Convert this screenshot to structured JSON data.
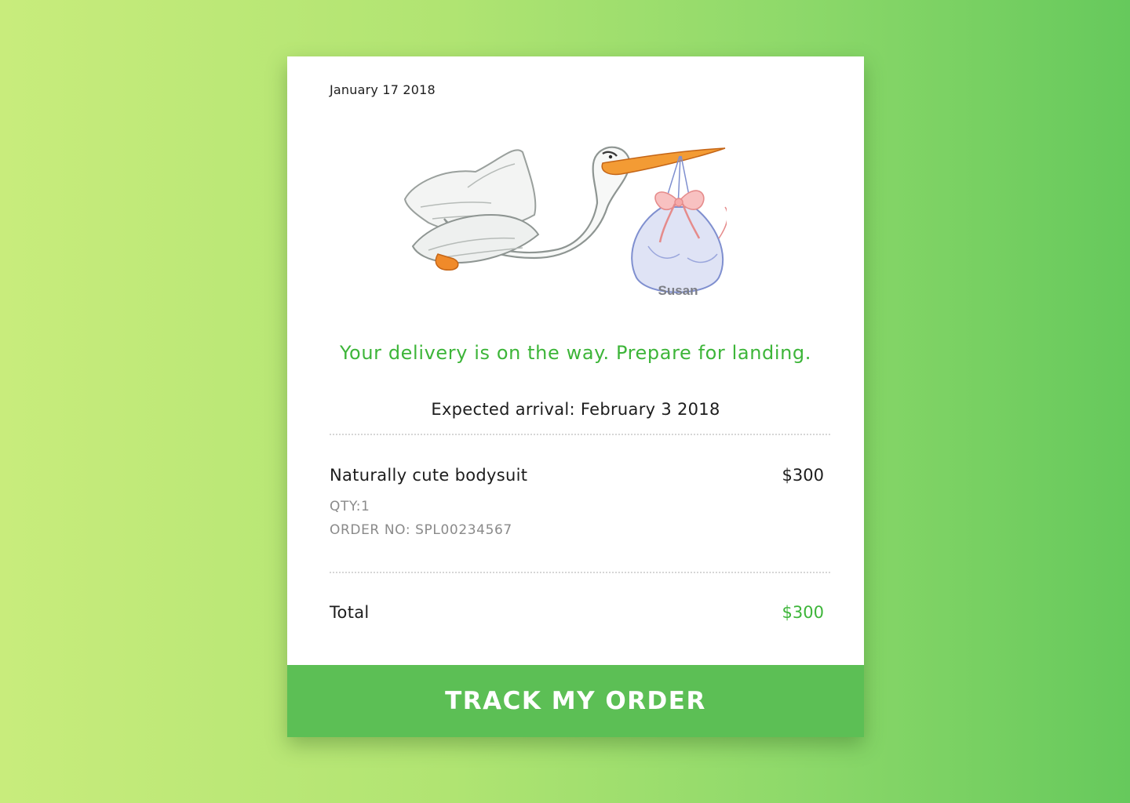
{
  "card": {
    "date": "January 17 2018",
    "illustration": {
      "name_on_bundle": "Susan",
      "icon": "stork-carrying-bundle-illustration"
    },
    "headline": "Your delivery is on the way. Prepare for landing.",
    "arrival": "Expected arrival: February 3 2018",
    "item": {
      "name": "Naturally cute bodysuit",
      "price": "$300",
      "qty": "QTY:1",
      "order_no": "ORDER NO: SPL00234567"
    },
    "total": {
      "label": "Total",
      "value": "$300"
    },
    "button_label": "TRACK MY ORDER"
  },
  "colors": {
    "accent": "#3db539",
    "button": "#5cbf55",
    "background_start": "#c8ec7c",
    "background_end": "#66c95c"
  }
}
